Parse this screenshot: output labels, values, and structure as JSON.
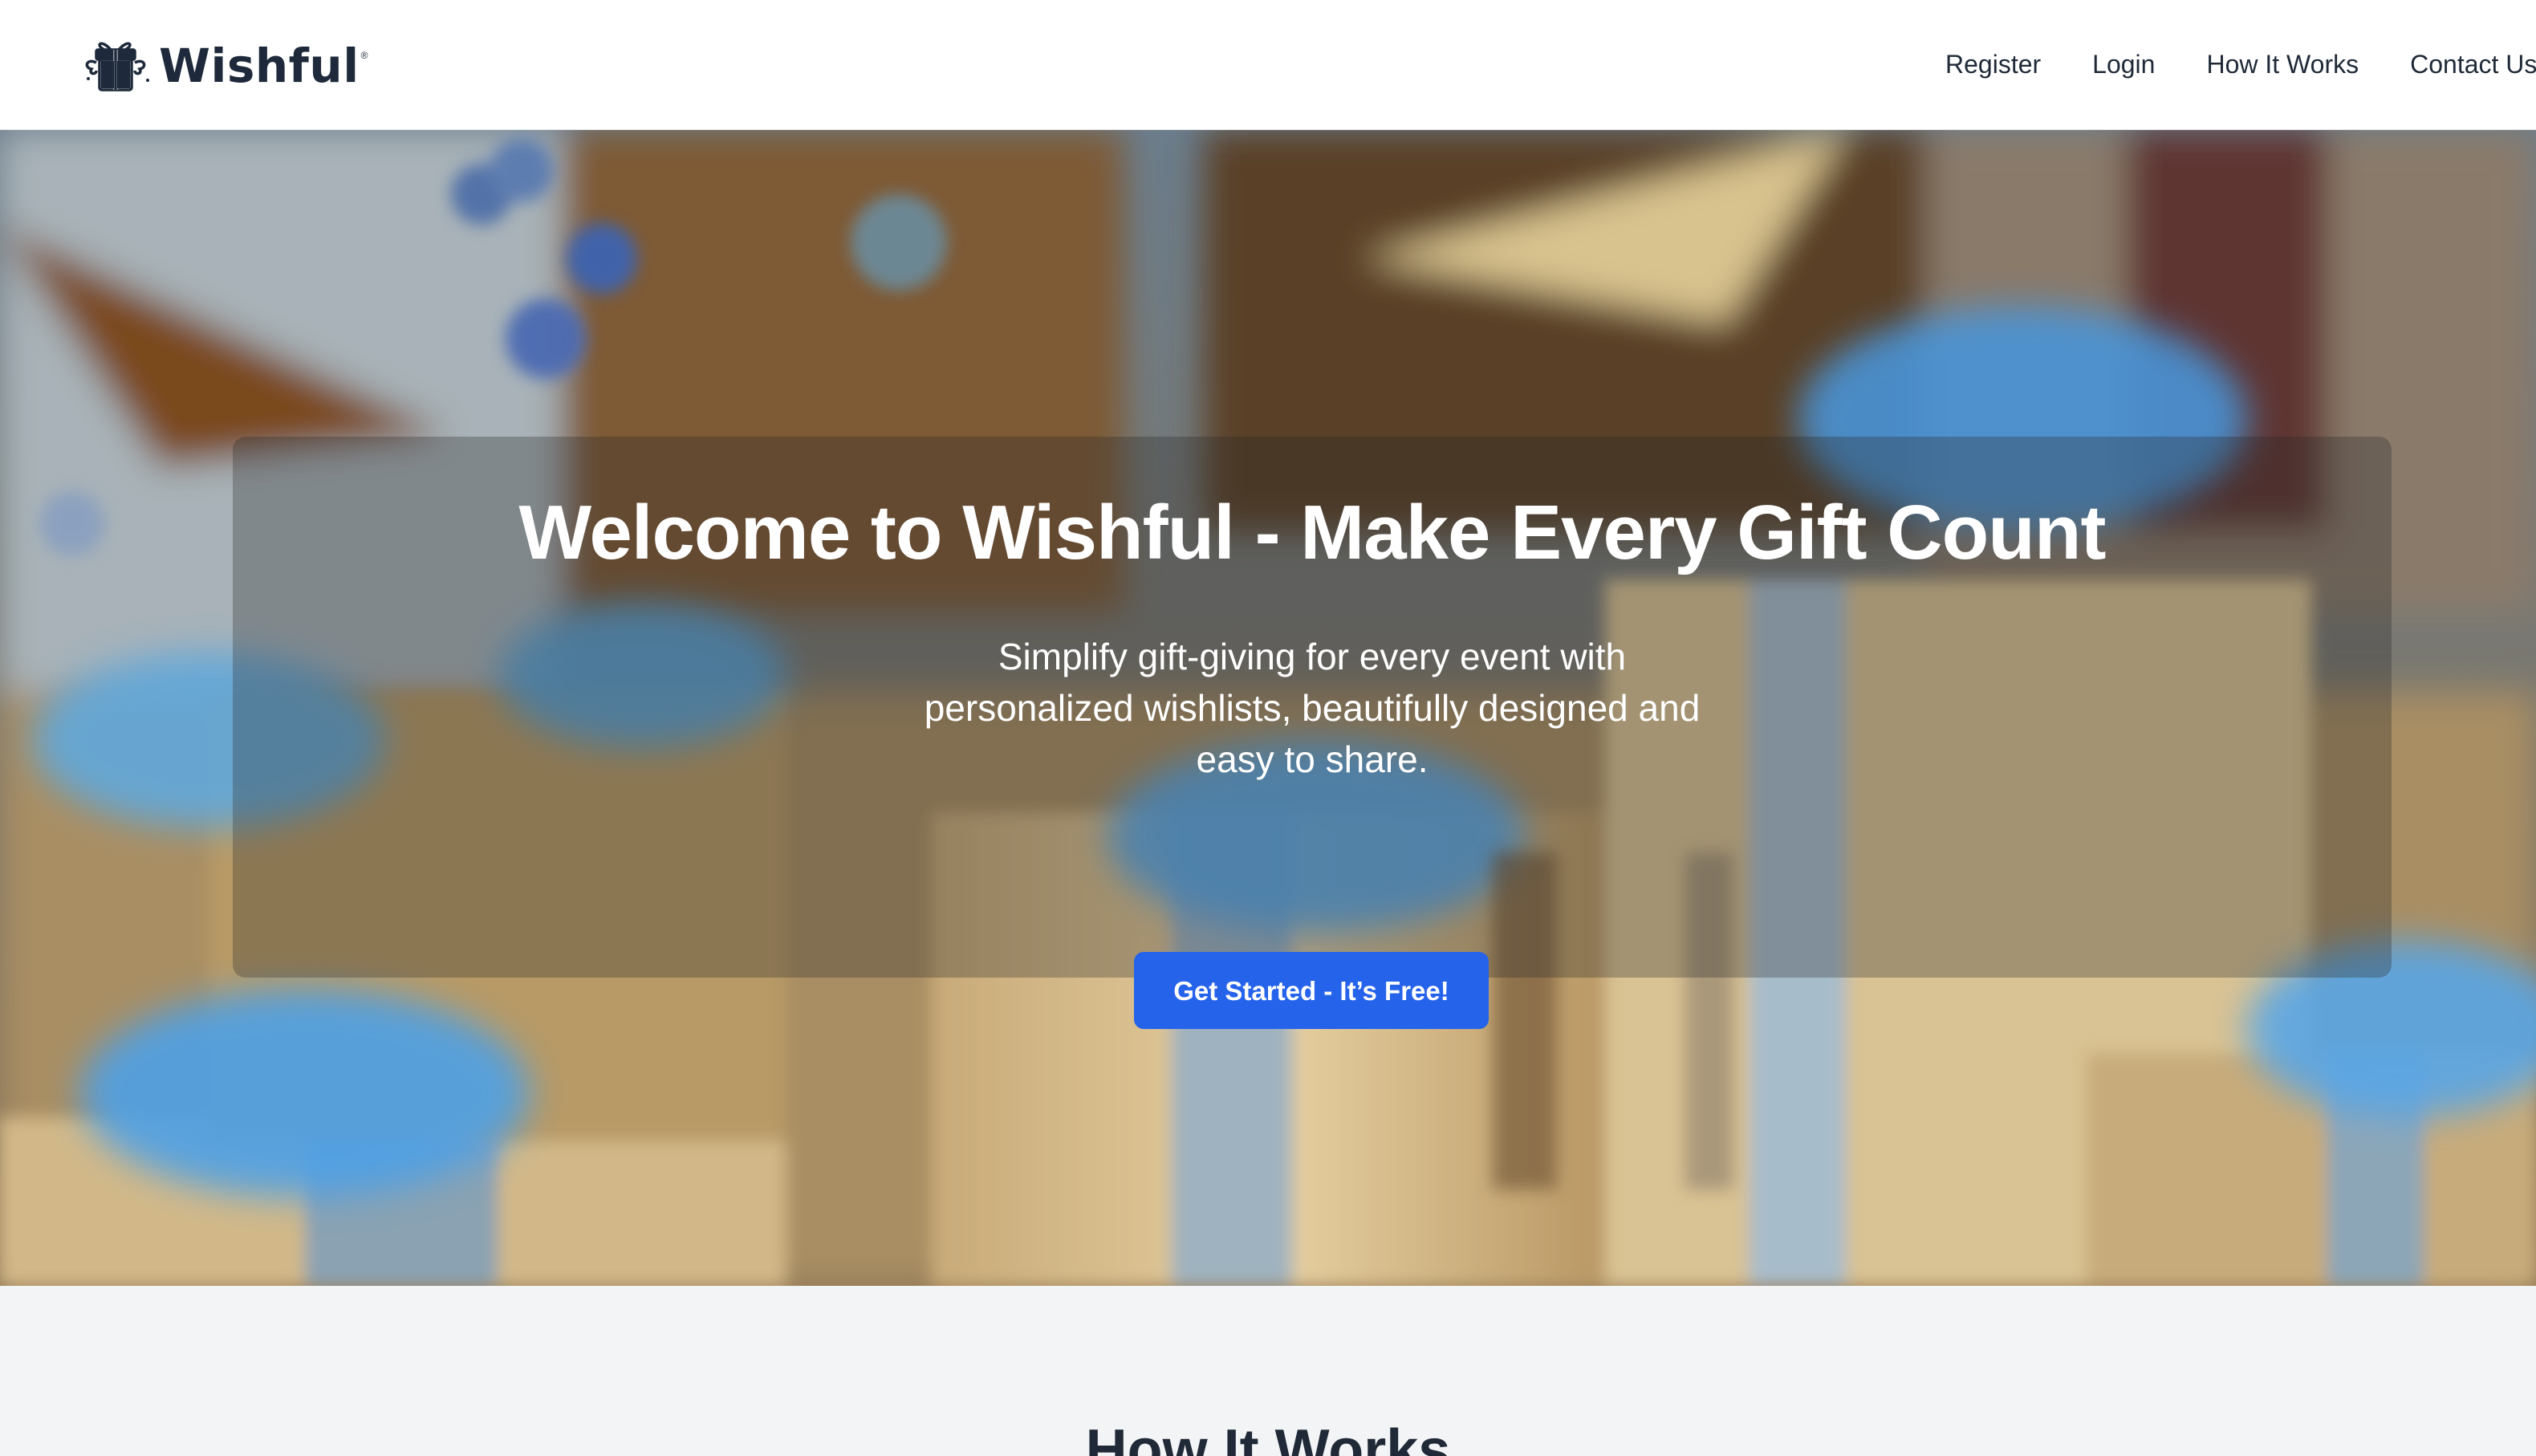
{
  "brand": {
    "name": "Wishful",
    "trademark": "®"
  },
  "nav": {
    "items": [
      {
        "label": "Register"
      },
      {
        "label": "Login"
      },
      {
        "label": "How It Works"
      },
      {
        "label": "Contact Us"
      }
    ]
  },
  "hero": {
    "title": "Welcome to Wishful - Make Every Gift Count",
    "subtitle": "Simplify gift-giving for every event with personalized wishlists, beautifully designed and easy to share.",
    "cta_label": "Get Started - It’s Free!",
    "background": "blurred-gift-boxes-photo"
  },
  "how_it_works": {
    "title": "How It Works"
  },
  "colors": {
    "primary": "#2563eb",
    "text_dark": "#1f2937",
    "section_bg": "#f3f4f6",
    "navbar_bg": "#ffffff"
  },
  "icons": {
    "logo": "gift-box-icon"
  }
}
